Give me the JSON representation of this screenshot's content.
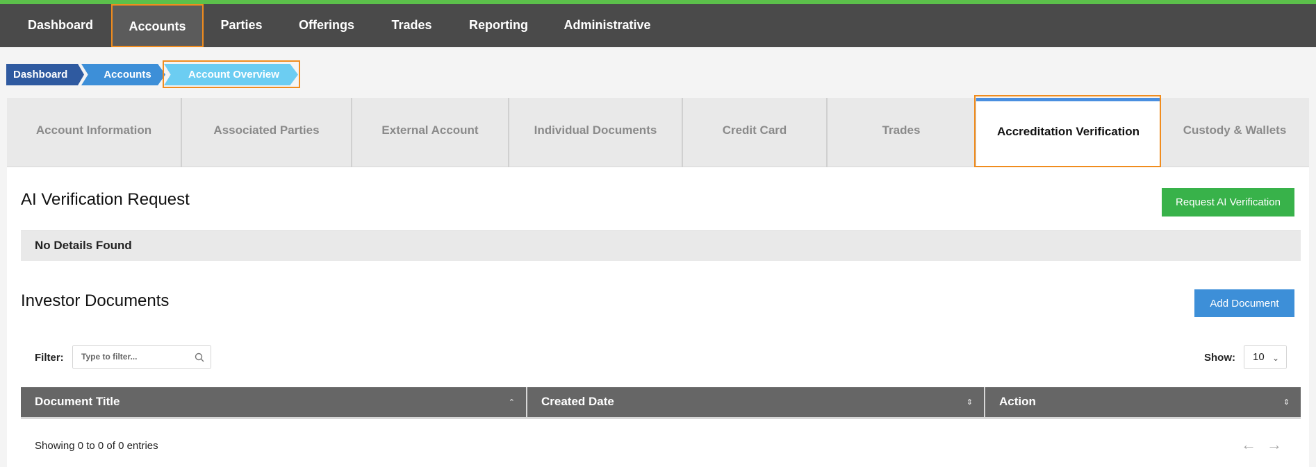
{
  "nav": {
    "items": [
      "Dashboard",
      "Accounts",
      "Parties",
      "Offerings",
      "Trades",
      "Reporting",
      "Administrative"
    ],
    "active": "Accounts"
  },
  "breadcrumb": [
    "Dashboard",
    "Accounts",
    "Account Overview"
  ],
  "tabs": {
    "items": [
      "Account Information",
      "Associated Parties",
      "External Account",
      "Individual Documents",
      "Credit Card",
      "Trades",
      "Accreditation Verification",
      "Custody & Wallets"
    ],
    "active": "Accreditation Verification"
  },
  "ai_section": {
    "title": "AI Verification Request",
    "button": "Request AI Verification",
    "empty": "No Details Found"
  },
  "docs_section": {
    "title": "Investor Documents",
    "button": "Add Document",
    "filter_label": "Filter:",
    "filter_placeholder": "Type to filter...",
    "show_label": "Show:",
    "show_value": "10",
    "columns": [
      "Document Title",
      "Created Date",
      "Action"
    ],
    "showing": "Showing 0 to 0 of 0 entries",
    "prev": "←",
    "next": "→"
  },
  "colors": {
    "nav_bg": "#4a4a4a",
    "accent_green": "#38b24a",
    "accent_blue": "#3d8fd8",
    "highlight": "#f08c1e"
  }
}
